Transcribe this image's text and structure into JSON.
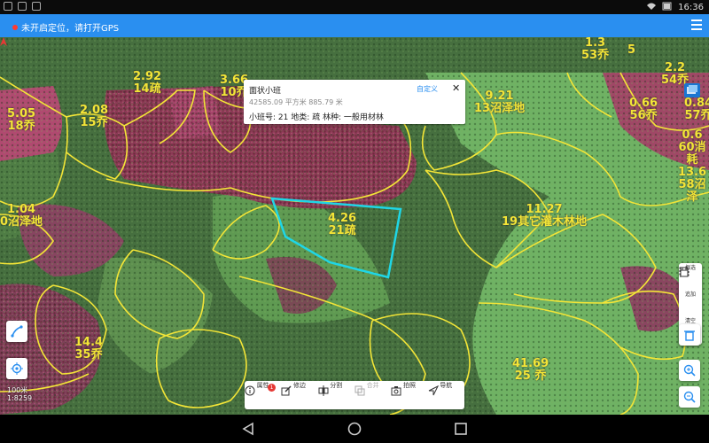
{
  "status_bar": {
    "time": "16:36"
  },
  "app_bar": {
    "gps_message": "未开启定位，请打开GPS"
  },
  "popup": {
    "title": "面状小班",
    "custom_label": "自定义",
    "close": "✕",
    "area": "42585.09 平方米   885.79 米",
    "info": "小班号: 21  地类: 疏  林种: 一般用材林"
  },
  "map_labels": [
    {
      "text": "5.05\n18乔"
    },
    {
      "text": "2.08\n15乔"
    },
    {
      "text": "2.92\n14疏"
    },
    {
      "text": "3.66\n10乔"
    },
    {
      "text": "1.04\n0沼泽地"
    },
    {
      "text": "4.26\n21疏"
    },
    {
      "text": "9.21\n13沼泽地"
    },
    {
      "text": "11.27\n19其它灌木林地"
    },
    {
      "text": "1.3\n53乔"
    },
    {
      "text": "2.2\n54乔"
    },
    {
      "text": "0.66\n56乔"
    },
    {
      "text": "0.84\n57乔"
    },
    {
      "text": "0.6\n60消耗"
    },
    {
      "text": "13.6\n58沼泽"
    },
    {
      "text": "14.4\n35乔"
    },
    {
      "text": "41.69\n25 乔"
    },
    {
      "text": "5"
    }
  ],
  "toolbar": {
    "attr": "属性",
    "attr_badge": "1",
    "edit": "修边",
    "split": "分割",
    "merge": "合并",
    "photo": "拍照",
    "nav": "导航"
  },
  "side_panel": {
    "frame": "框选",
    "add": "追加",
    "clear": "清空"
  },
  "scale": {
    "line1": "100米",
    "line2": "1:8259"
  },
  "colors": {
    "appbar": "#2a8ff0",
    "boundary": "#f3e537",
    "selected": "#1fd6e6"
  }
}
